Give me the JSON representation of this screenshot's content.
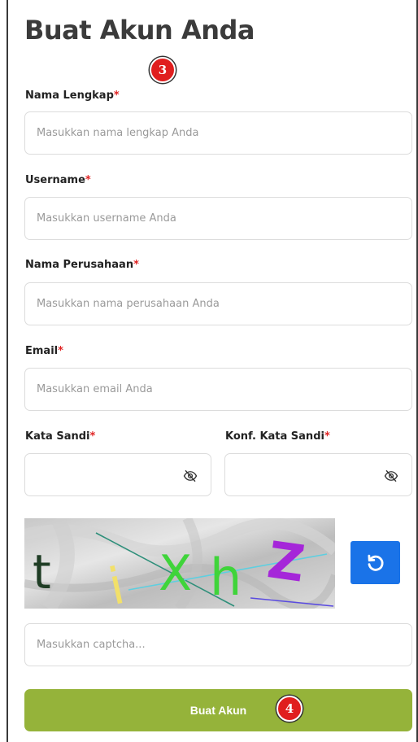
{
  "form": {
    "title": "Buat Akun Anda",
    "required_mark": "*",
    "fields": {
      "full_name": {
        "label": "Nama Lengkap",
        "placeholder": "Masukkan nama lengkap Anda",
        "value": ""
      },
      "username": {
        "label": "Username",
        "placeholder": "Masukkan username Anda",
        "value": ""
      },
      "company": {
        "label": "Nama Perusahaan",
        "placeholder": "Masukkan nama perusahaan Anda",
        "value": ""
      },
      "email": {
        "label": "Email",
        "placeholder": "Masukkan email Anda",
        "value": ""
      },
      "password": {
        "label": "Kata Sandi",
        "placeholder": "",
        "value": ""
      },
      "confirm_password": {
        "label": "Konf. Kata Sandi",
        "placeholder": "",
        "value": ""
      },
      "captcha": {
        "placeholder": "Masukkan captcha...",
        "value": ""
      }
    },
    "captcha_image": {
      "letters": [
        "t",
        "i",
        "X",
        "h",
        "Z"
      ],
      "colors": [
        "#1f3d25",
        "#f2e06a",
        "#3fd43a",
        "#3fd43a",
        "#a526d9"
      ]
    },
    "submit_label": "Buat Akun"
  },
  "annotations": {
    "marker_3": "3",
    "marker_4": "4"
  },
  "icons": {
    "password_toggle": "eye-slash-icon",
    "refresh": "refresh-icon"
  },
  "colors": {
    "submit_bg": "#95b33a",
    "refresh_bg": "#1a73e8",
    "required": "#e02424",
    "marker": "#e01e1e"
  }
}
